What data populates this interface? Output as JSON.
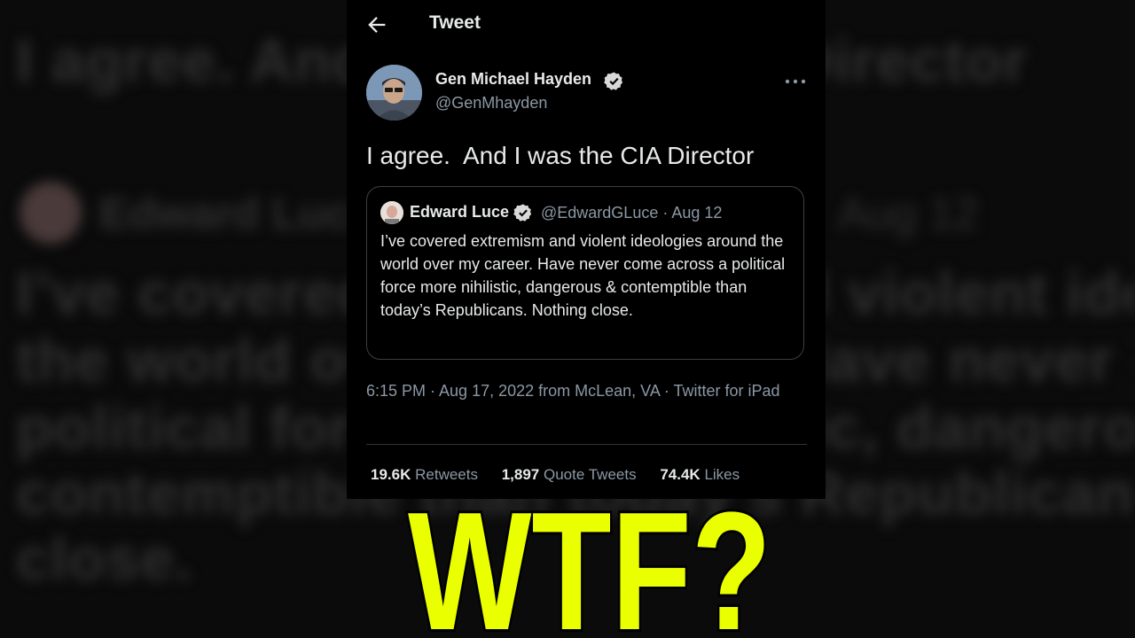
{
  "header": {
    "title": "Tweet",
    "back_icon": "arrow-left-icon"
  },
  "tweet": {
    "author_name": "Gen Michael Hayden",
    "author_handle": "@GenMhayden",
    "text": "I agree.  And I was the CIA Director",
    "more_icon": "more-horizontal-icon",
    "verified_icon": "verified-badge-icon"
  },
  "quoted": {
    "author_name": "Edward Luce",
    "handle_date": "@EdwardGLuce · Aug 12",
    "text": "I’ve covered extremism and violent ideologies around the world over my career. Have never come across a political force more nihilistic, dangerous & contemptible than today’s Republicans. Nothing close."
  },
  "meta": "6:15 PM · Aug 17, 2022 from McLean, VA · Twitter for iPad",
  "stats": [
    {
      "value": "19.6K",
      "label": "Retweets"
    },
    {
      "value": "1,897",
      "label": "Quote Tweets"
    },
    {
      "value": "74.4K",
      "label": "Likes"
    }
  ],
  "overlay": {
    "text": "WTF?",
    "color": "#eaff00"
  },
  "background": {
    "line1": "I agree.  And I was the CIA Director",
    "name": "Edward Luce",
    "date": "Aug 12",
    "lines": [
      "I’ve covered extremism and violent ideologies around",
      "the world over my career. Have never come across a",
      "political force more nihilistic, dangerous &",
      "contemptible than today’s Republicans. Nothing",
      "close."
    ]
  },
  "colors": {
    "card_bg": "#000000",
    "text": "#e7e9ea",
    "muted": "#8b98a5",
    "verified": "#d9d9d9"
  }
}
